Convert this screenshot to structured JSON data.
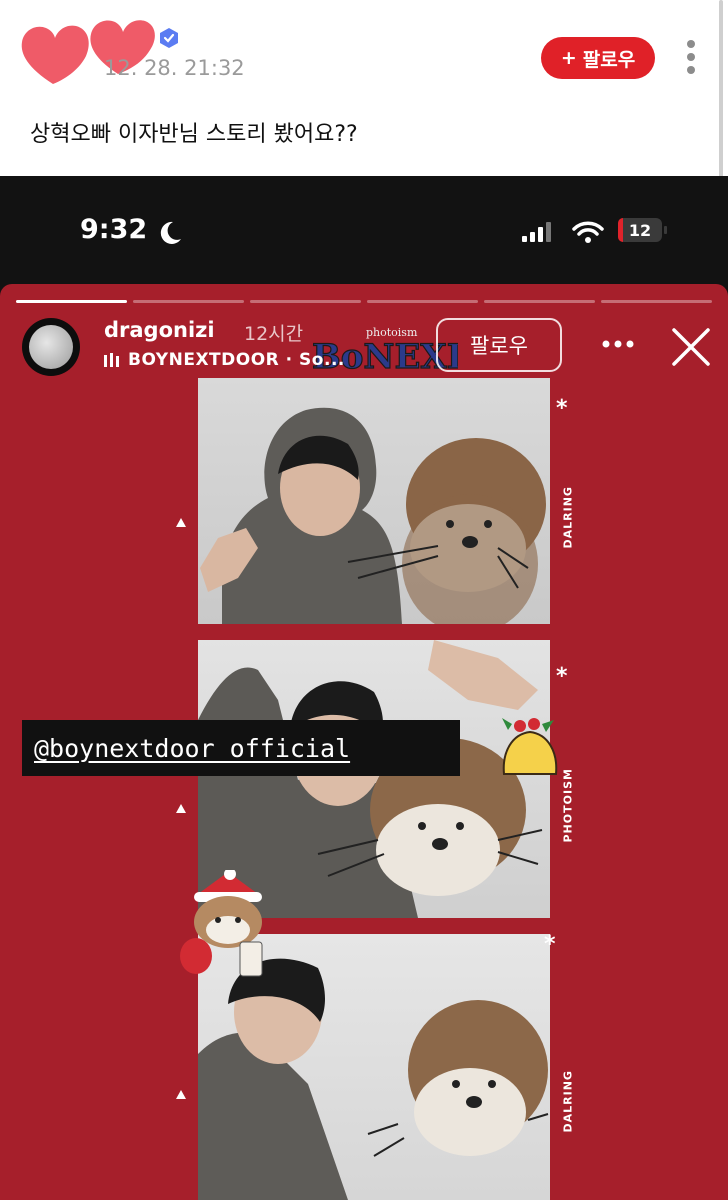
{
  "post": {
    "date": "12. 28. 21:32",
    "follow_label": "팔로우",
    "follow_plus": "+",
    "text": "상혁오빠 이자반님 스토리 봤어요??"
  },
  "phone": {
    "time": "9:32",
    "battery": "12",
    "battery_level": 0.12
  },
  "story": {
    "username": "dragonizi",
    "time_ago": "12시간",
    "music": "BOYNEXTDOOR · So...",
    "follow_label": "팔로우",
    "logo_text": "BoNEXDO",
    "photo_brand": "photoism",
    "mention": "@boynextdoor_official",
    "side_labels": [
      "DALRING",
      "PHOTOISM",
      "DALRING"
    ],
    "progress_segments": 6,
    "progress_done": 1
  },
  "colors": {
    "accent": "#e02128",
    "story_bg": "#a61f2b"
  }
}
